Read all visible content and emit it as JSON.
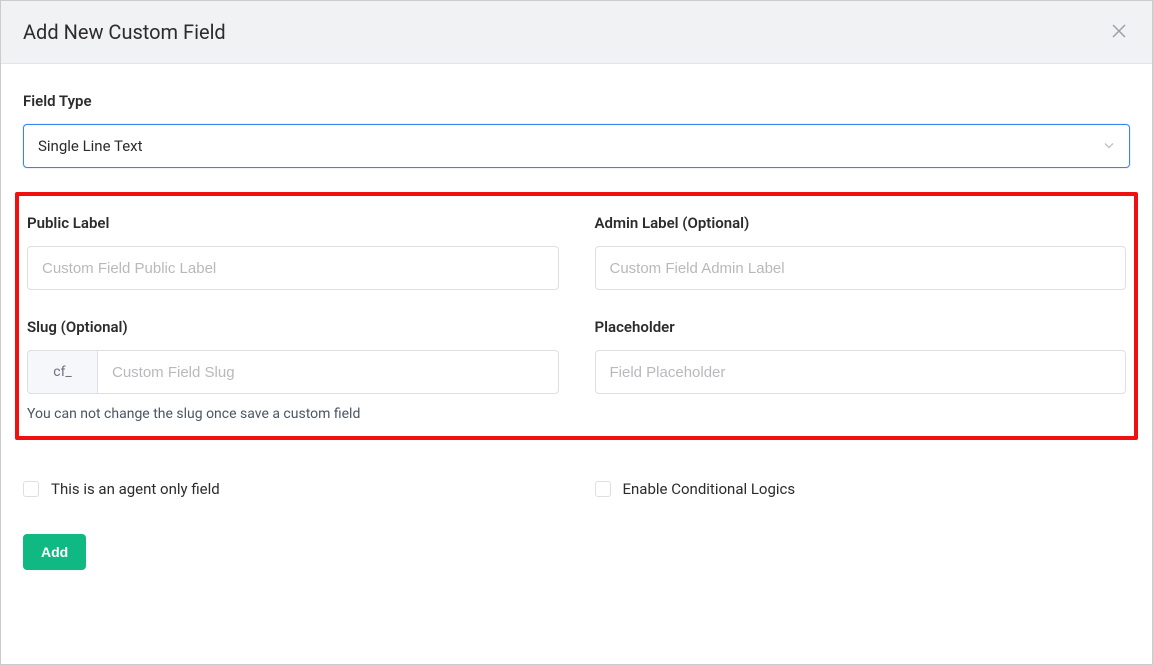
{
  "modal": {
    "title": "Add New Custom Field"
  },
  "field_type": {
    "label": "Field Type",
    "selected": "Single Line Text"
  },
  "public_label": {
    "label": "Public Label",
    "placeholder": "Custom Field Public Label",
    "value": ""
  },
  "admin_label": {
    "label": "Admin Label (Optional)",
    "placeholder": "Custom Field Admin Label",
    "value": ""
  },
  "slug": {
    "label": "Slug (Optional)",
    "prefix": "cf_",
    "placeholder": "Custom Field Slug",
    "value": "",
    "hint": "You can not change the slug once save a custom field"
  },
  "placeholder_field": {
    "label": "Placeholder",
    "placeholder": "Field Placeholder",
    "value": ""
  },
  "agent_only": {
    "label": "This is an agent only field",
    "checked": false
  },
  "conditional_logics": {
    "label": "Enable Conditional Logics",
    "checked": false
  },
  "submit": {
    "label": "Add"
  }
}
